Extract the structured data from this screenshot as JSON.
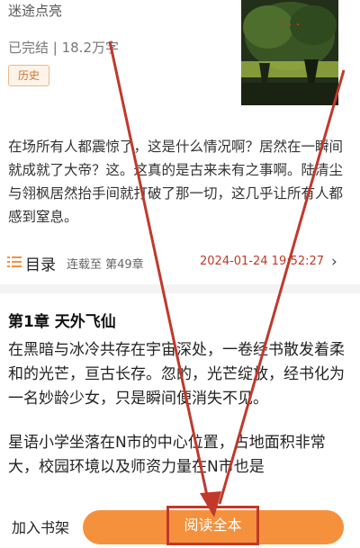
{
  "book": {
    "author": "迷途点亮",
    "status": "已完结 | 18.2万字",
    "history_tag": "历史"
  },
  "description": "在场所有人都震惊了，这是什么情况啊？居然在一瞬间就成就了大帝？这。这真的是古来未有之事啊。陆清尘与翎枫居然抬手间就打破了那一切，这几乎让所有人都感到窒息。",
  "toc": {
    "label": "目录",
    "status": "连载至 第49章",
    "updated": "2024-01-24 19:52:27",
    "chevron": "›"
  },
  "chapter": {
    "title": "第1章 天外飞仙",
    "paragraphs": [
      "在黑暗与冰冷共存在宇宙深处，一卷经书散发着柔和的光芒，亘古长存。忽的，光芒绽放，经书化为一名妙龄少女，只是瞬间便消失不见。",
      "星语小学坐落在N市的中心位置，占地面积非常大，校园环境以及师资力量在N市也是"
    ]
  },
  "bottom_bar": {
    "add_shelf": "加入书架",
    "read_all": "阅读全本"
  },
  "colors": {
    "accent_orange": "#f5913c",
    "annotation_red": "#c0392b"
  }
}
